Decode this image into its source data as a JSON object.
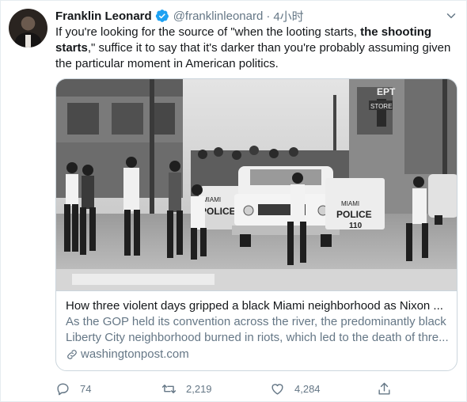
{
  "author": {
    "name": "Franklin Leonard",
    "handle": "@franklinleonard",
    "separator": "·",
    "time": "4小时"
  },
  "tweet": {
    "text_part1": "If you're looking for the source of \"when the looting starts, ",
    "text_bold": "the shooting starts",
    "text_part2": ",\" suffice it to say that it's darker than you're probably assuming given the particular moment in American politics."
  },
  "card": {
    "image_texts": {
      "sign1": "EPT",
      "sign2": "STORE",
      "car_left_line1": "MIAMI",
      "car_left_line2": "POLICE",
      "car_right_line1": "MIAMI",
      "car_right_line2": "POLICE",
      "car_right_number": "110"
    },
    "title": "How three violent days gripped a black Miami neighborhood as Nixon ...",
    "description_line1": "As the GOP held its convention across the river, the predominantly black",
    "description_line2": "Liberty City neighborhood burned in riots, which led to the death of thre...",
    "domain": "washingtonpost.com"
  },
  "actions": {
    "reply_count": "74",
    "retweet_count": "2,219",
    "like_count": "4,284"
  },
  "colors": {
    "verified": "#1da1f2",
    "secondary_text": "#657786",
    "border": "#ccd6dd"
  },
  "icons": [
    "verified-badge-icon",
    "chevron-down-icon",
    "link-icon",
    "reply-icon",
    "retweet-icon",
    "like-icon",
    "share-icon"
  ]
}
